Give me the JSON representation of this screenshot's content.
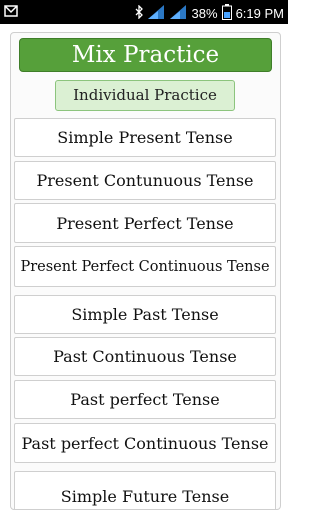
{
  "status_bar": {
    "signal_icon": "signal-icon",
    "battery_percent": "38%",
    "time": "6:19 PM"
  },
  "buttons": {
    "mix_practice": "Mix Practice",
    "individual_practice": "Individual Practice"
  },
  "tenses": [
    "Simple Present Tense",
    "Present Contunuous Tense",
    "Present Perfect Tense",
    "Present Perfect Continuous Tense",
    "Simple Past Tense",
    "Past Continuous Tense",
    "Past perfect Tense",
    "Past perfect Continuous Tense",
    "Simple Future Tense"
  ],
  "colors": {
    "mix_button_bg": "#56a03a",
    "individual_button_bg": "#dbf0d3"
  }
}
